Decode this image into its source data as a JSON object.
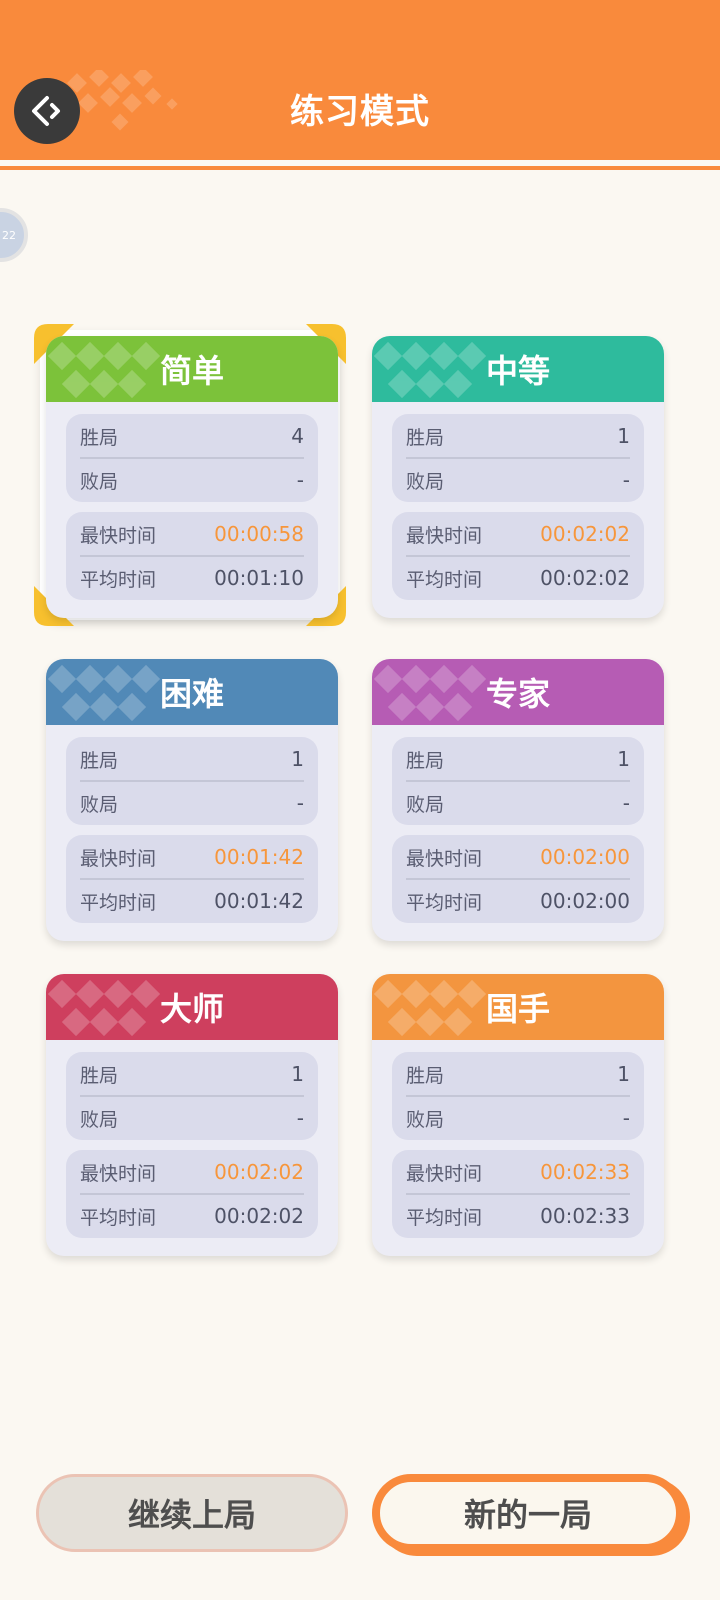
{
  "header": {
    "title": "练习模式",
    "back_icon": "back-arrow-icon",
    "color": "#F98A3C"
  },
  "avatar_text": "22",
  "stats_labels": {
    "wins": "胜局",
    "losses": "败局",
    "fastest": "最快时间",
    "average": "平均时间"
  },
  "cards": [
    {
      "name": "简单",
      "color": "#7CC23A",
      "wins": "4",
      "losses": "-",
      "fastest": "00:00:58",
      "average": "00:01:10",
      "selected": true
    },
    {
      "name": "中等",
      "color": "#2EBB9D",
      "wins": "1",
      "losses": "-",
      "fastest": "00:02:02",
      "average": "00:02:02",
      "selected": false
    },
    {
      "name": "困难",
      "color": "#5189B7",
      "wins": "1",
      "losses": "-",
      "fastest": "00:01:42",
      "average": "00:01:42",
      "selected": false
    },
    {
      "name": "专家",
      "color": "#B65CB4",
      "wins": "1",
      "losses": "-",
      "fastest": "00:02:00",
      "average": "00:02:00",
      "selected": false
    },
    {
      "name": "大师",
      "color": "#CE3F5E",
      "wins": "1",
      "losses": "-",
      "fastest": "00:02:02",
      "average": "00:02:02",
      "selected": false
    },
    {
      "name": "国手",
      "color": "#F3953F",
      "wins": "1",
      "losses": "-",
      "fastest": "00:02:33",
      "average": "00:02:33",
      "selected": false
    }
  ],
  "buttons": {
    "continue": "继续上局",
    "new_game": "新的一局"
  }
}
